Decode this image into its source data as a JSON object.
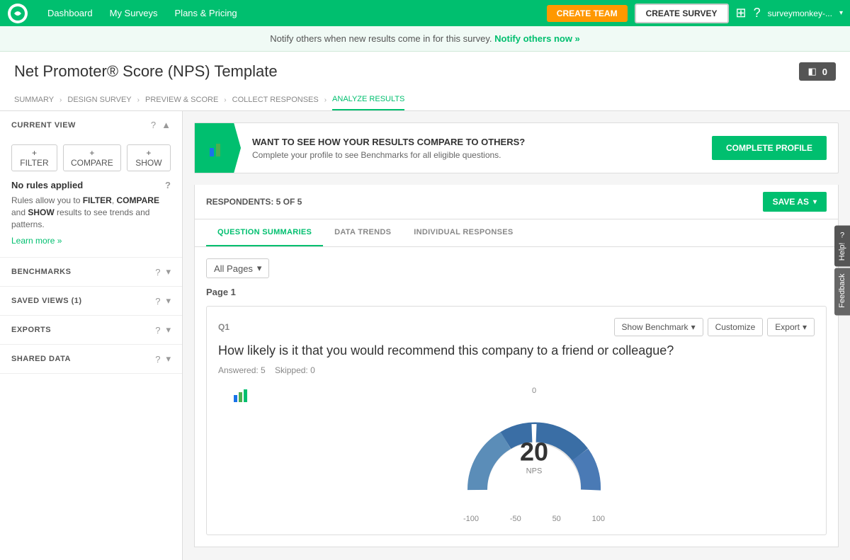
{
  "nav": {
    "logo_alt": "SurveyMonkey",
    "links": [
      {
        "id": "dashboard",
        "label": "Dashboard"
      },
      {
        "id": "my-surveys",
        "label": "My Surveys"
      },
      {
        "id": "plans-pricing",
        "label": "Plans & Pricing"
      }
    ],
    "create_team_label": "CREATE TEAM",
    "create_survey_label": "CREATE SURVEY",
    "user_label": "surveymonkey-...",
    "grid_icon": "⊞",
    "help_icon": "?"
  },
  "notify_bar": {
    "text": "Notify others when new results come in for this survey.",
    "link_text": "Notify others now »"
  },
  "page": {
    "title": "Net Promoter® Score (NPS) Template",
    "toggle_label": "0"
  },
  "breadcrumb": {
    "items": [
      {
        "id": "summary",
        "label": "SUMMARY",
        "active": false
      },
      {
        "id": "design-survey",
        "label": "DESIGN SURVEY",
        "active": false
      },
      {
        "id": "preview-score",
        "label": "PREVIEW & SCORE",
        "active": false
      },
      {
        "id": "collect-responses",
        "label": "COLLECT RESPONSES",
        "active": false
      },
      {
        "id": "analyze-results",
        "label": "ANALYZE RESULTS",
        "active": true
      }
    ]
  },
  "sidebar": {
    "current_view_label": "CURRENT VIEW",
    "filter_label": "+ FILTER",
    "compare_label": "+ COMPARE",
    "show_label": "+ SHOW",
    "no_rules_label": "No rules applied",
    "rules_desc_part1": "Rules allow you to ",
    "rules_filter": "FILTER",
    "rules_compare": "COMPARE",
    "rules_and": " and ",
    "rules_show": "SHOW",
    "rules_desc_part2": " results to see trends and patterns.",
    "learn_more": "Learn more »",
    "benchmarks_label": "BENCHMARKS",
    "saved_views_label": "SAVED VIEWS (1)",
    "exports_label": "EXPORTS",
    "shared_data_label": "SHARED DATA"
  },
  "benchmark_banner": {
    "heading": "WANT TO SEE HOW YOUR RESULTS COMPARE TO OTHERS?",
    "description": "Complete your profile to see Benchmarks for all eligible questions.",
    "button_label": "COMPLETE PROFILE"
  },
  "respondents": {
    "text": "RESPONDENTS: 5 of 5",
    "save_as_label": "SAVE AS"
  },
  "tabs": [
    {
      "id": "question-summaries",
      "label": "QUESTION SUMMARIES",
      "active": true
    },
    {
      "id": "data-trends",
      "label": "DATA TRENDS",
      "active": false
    },
    {
      "id": "individual-responses",
      "label": "INDIVIDUAL RESPONSES",
      "active": false
    }
  ],
  "pages_filter": {
    "label": "All Pages",
    "icon": "▾"
  },
  "question": {
    "page_label": "Page 1",
    "number": "Q1",
    "text": "How likely is it that you would recommend this company to a friend or colleague?",
    "answered": "Answered: 5",
    "skipped": "Skipped: 0",
    "show_benchmark_label": "Show Benchmark",
    "customize_label": "Customize",
    "export_label": "Export"
  },
  "nps_chart": {
    "score": "20",
    "label": "NPS",
    "scale_left": "-100",
    "scale_left_mid": "-50",
    "scale_top": "0",
    "scale_right_mid": "50",
    "scale_right": "100"
  },
  "feedback": {
    "help_label": "Help!",
    "feedback_label": "Feedback"
  }
}
